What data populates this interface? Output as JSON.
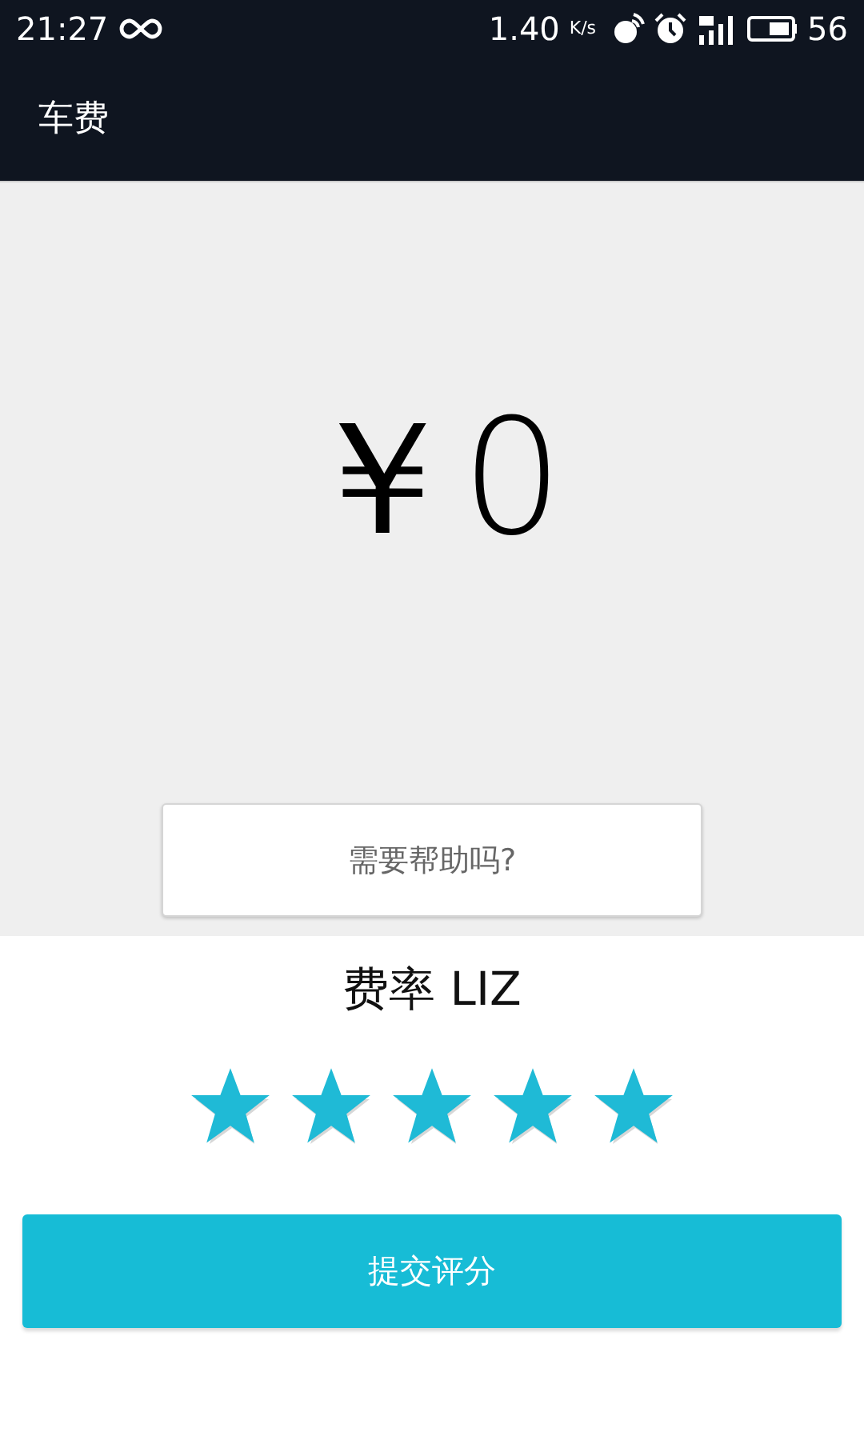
{
  "status_bar": {
    "time": "21:27",
    "speed": "1.40",
    "speed_unit": "K/s",
    "battery": "56"
  },
  "app_bar": {
    "title": "车费"
  },
  "fare": {
    "amount": "￥0",
    "help_button": "需要帮助吗?"
  },
  "rating": {
    "label": "费率 LIZ",
    "stars": 5
  },
  "submit_button": "提交评分"
}
